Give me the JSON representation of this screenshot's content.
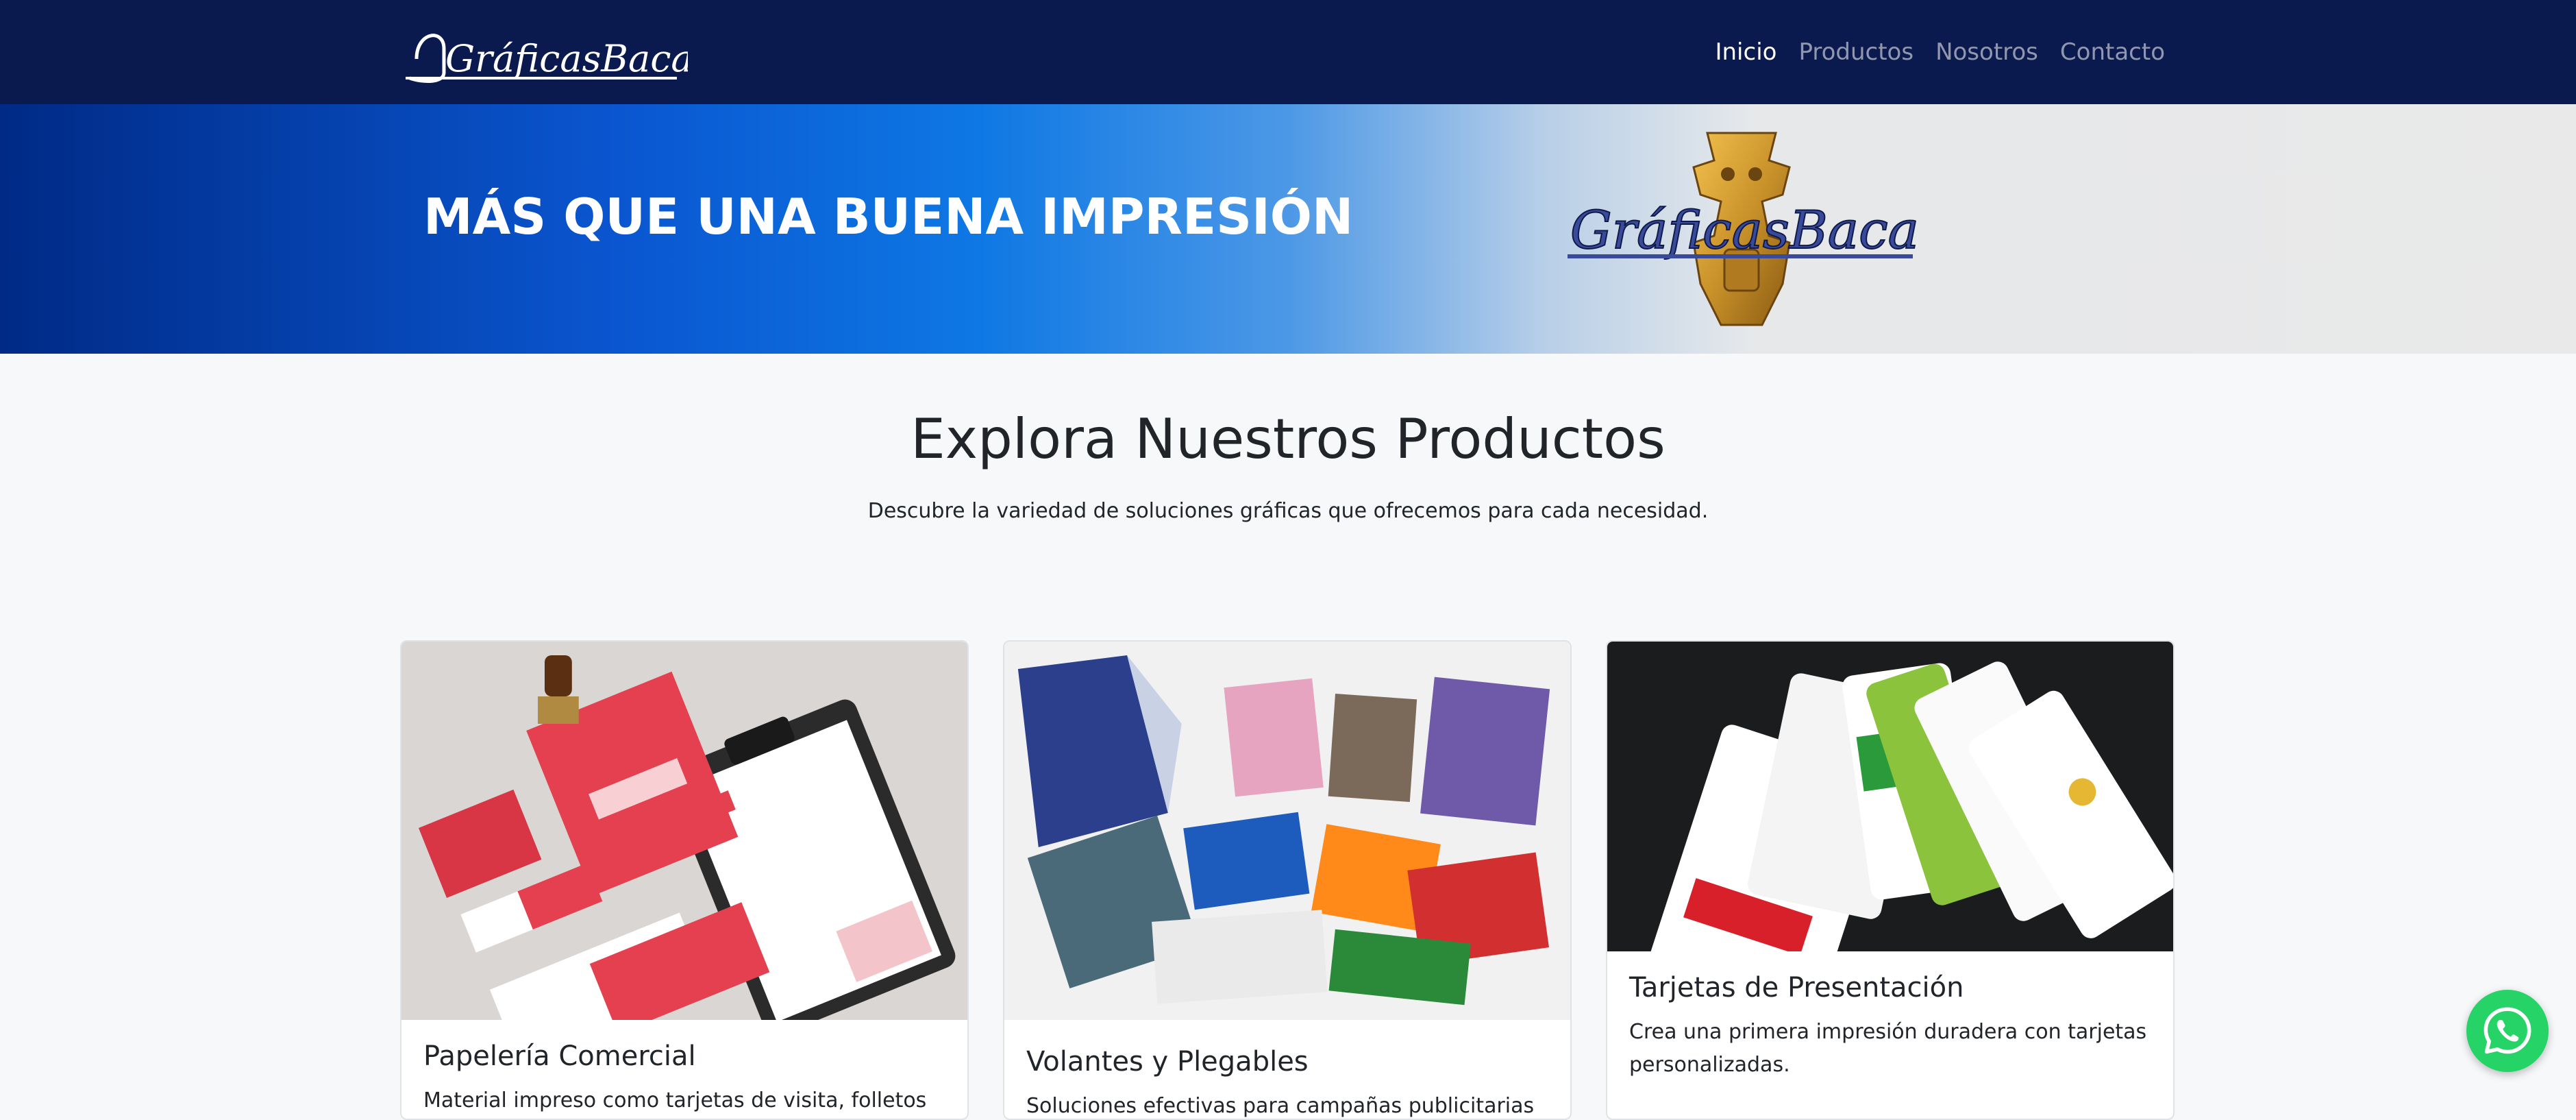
{
  "navbar": {
    "brand_text": "GráficasBacatá",
    "links": [
      {
        "label": "Inicio",
        "active": true
      },
      {
        "label": "Productos",
        "active": false
      },
      {
        "label": "Nosotros",
        "active": false
      },
      {
        "label": "Contacto",
        "active": false
      }
    ]
  },
  "hero": {
    "headline": "MÁS QUE UNA BUENA IMPRESIÓN",
    "logo_text": "GráficasBacatá"
  },
  "products_section": {
    "title": "Explora Nuestros Productos",
    "subtitle": "Descubre la variedad de soluciones gráficas que ofrecemos para cada necesidad."
  },
  "cards": [
    {
      "title": "Papelería Comercial",
      "text": "Material impreso como tarjetas de visita, folletos",
      "image_icon": "stationery-mockup-image"
    },
    {
      "title": "Volantes y Plegables",
      "text": "Soluciones efectivas para campañas publicitarias",
      "image_icon": "flyers-brochures-image"
    },
    {
      "title": "Tarjetas de Presentación",
      "text": "Crea una primera impresión duradera con tarjetas personalizadas.",
      "image_icon": "business-cards-image"
    }
  ],
  "whatsapp": {
    "icon": "whatsapp-icon"
  },
  "colors": {
    "navbar_bg": "#0b1a4e",
    "hero_blue": "#0e78e4",
    "whatsapp_green": "#25d366"
  }
}
